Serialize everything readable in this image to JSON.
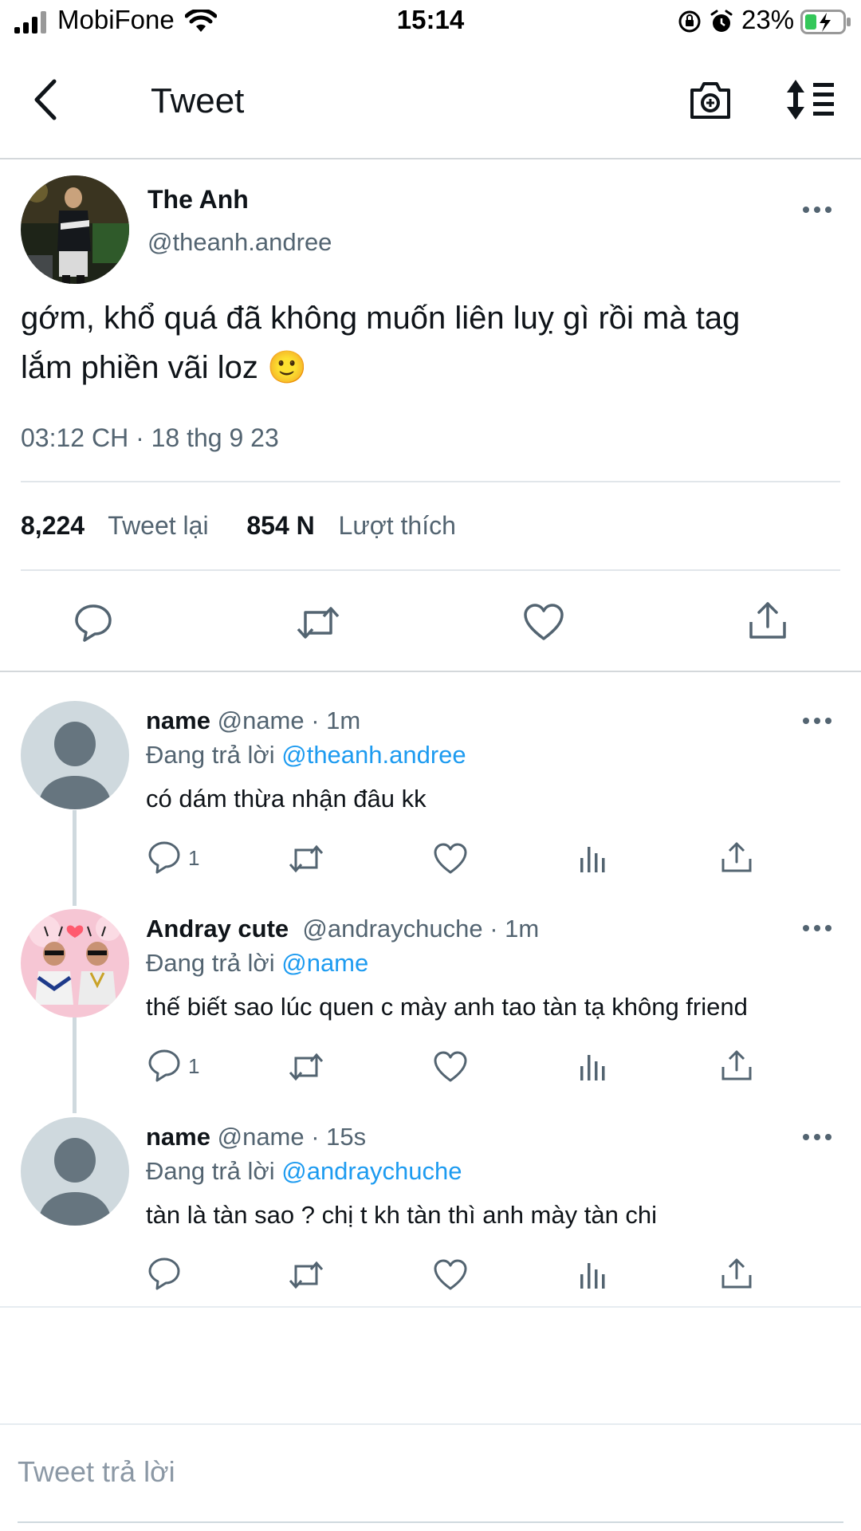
{
  "status_bar": {
    "carrier": "MobiFone",
    "time": "15:14",
    "battery": "23%"
  },
  "header": {
    "title": "Tweet"
  },
  "tweet": {
    "display_name": "The Anh",
    "handle": "@theanh.andree",
    "text_line1": "gớm, khổ quá đã không muốn liên luỵ gì rồi mà tag",
    "text_line2": "lắm phiền vãi loz 🙂",
    "timestamp": "03:12 CH · 18 thg 9 23",
    "retweet_count": "8,224",
    "retweet_label": "Tweet lại",
    "like_count": "854 N",
    "like_label": "Lượt thích"
  },
  "replies": [
    {
      "name": "name",
      "handle": "@name · 1m",
      "replying_prefix": "Đang trả lời ",
      "replying_to": "@theanh.andree",
      "text": "có dám thừa nhận đâu kk",
      "reply_count": "1"
    },
    {
      "name": "Andray cute",
      "handle": "@andraychuche · 1m",
      "replying_prefix": "Đang trả lời ",
      "replying_to": "@name",
      "text": "thế biết sao lúc quen c mày anh tao tàn tạ không friend",
      "reply_count": "1"
    },
    {
      "name": "name",
      "handle": "@name · 15s",
      "replying_prefix": "Đang trả lời ",
      "replying_to": "@andraychuche",
      "text": "tàn là tàn sao ? chị t kh tàn thì anh mày tàn chi",
      "reply_count": ""
    }
  ],
  "composer": {
    "placeholder": "Tweet trả lời"
  },
  "colors": {
    "accent": "#1d9bf0",
    "secondary_text": "#536471",
    "divider": "#e1e6ea"
  }
}
